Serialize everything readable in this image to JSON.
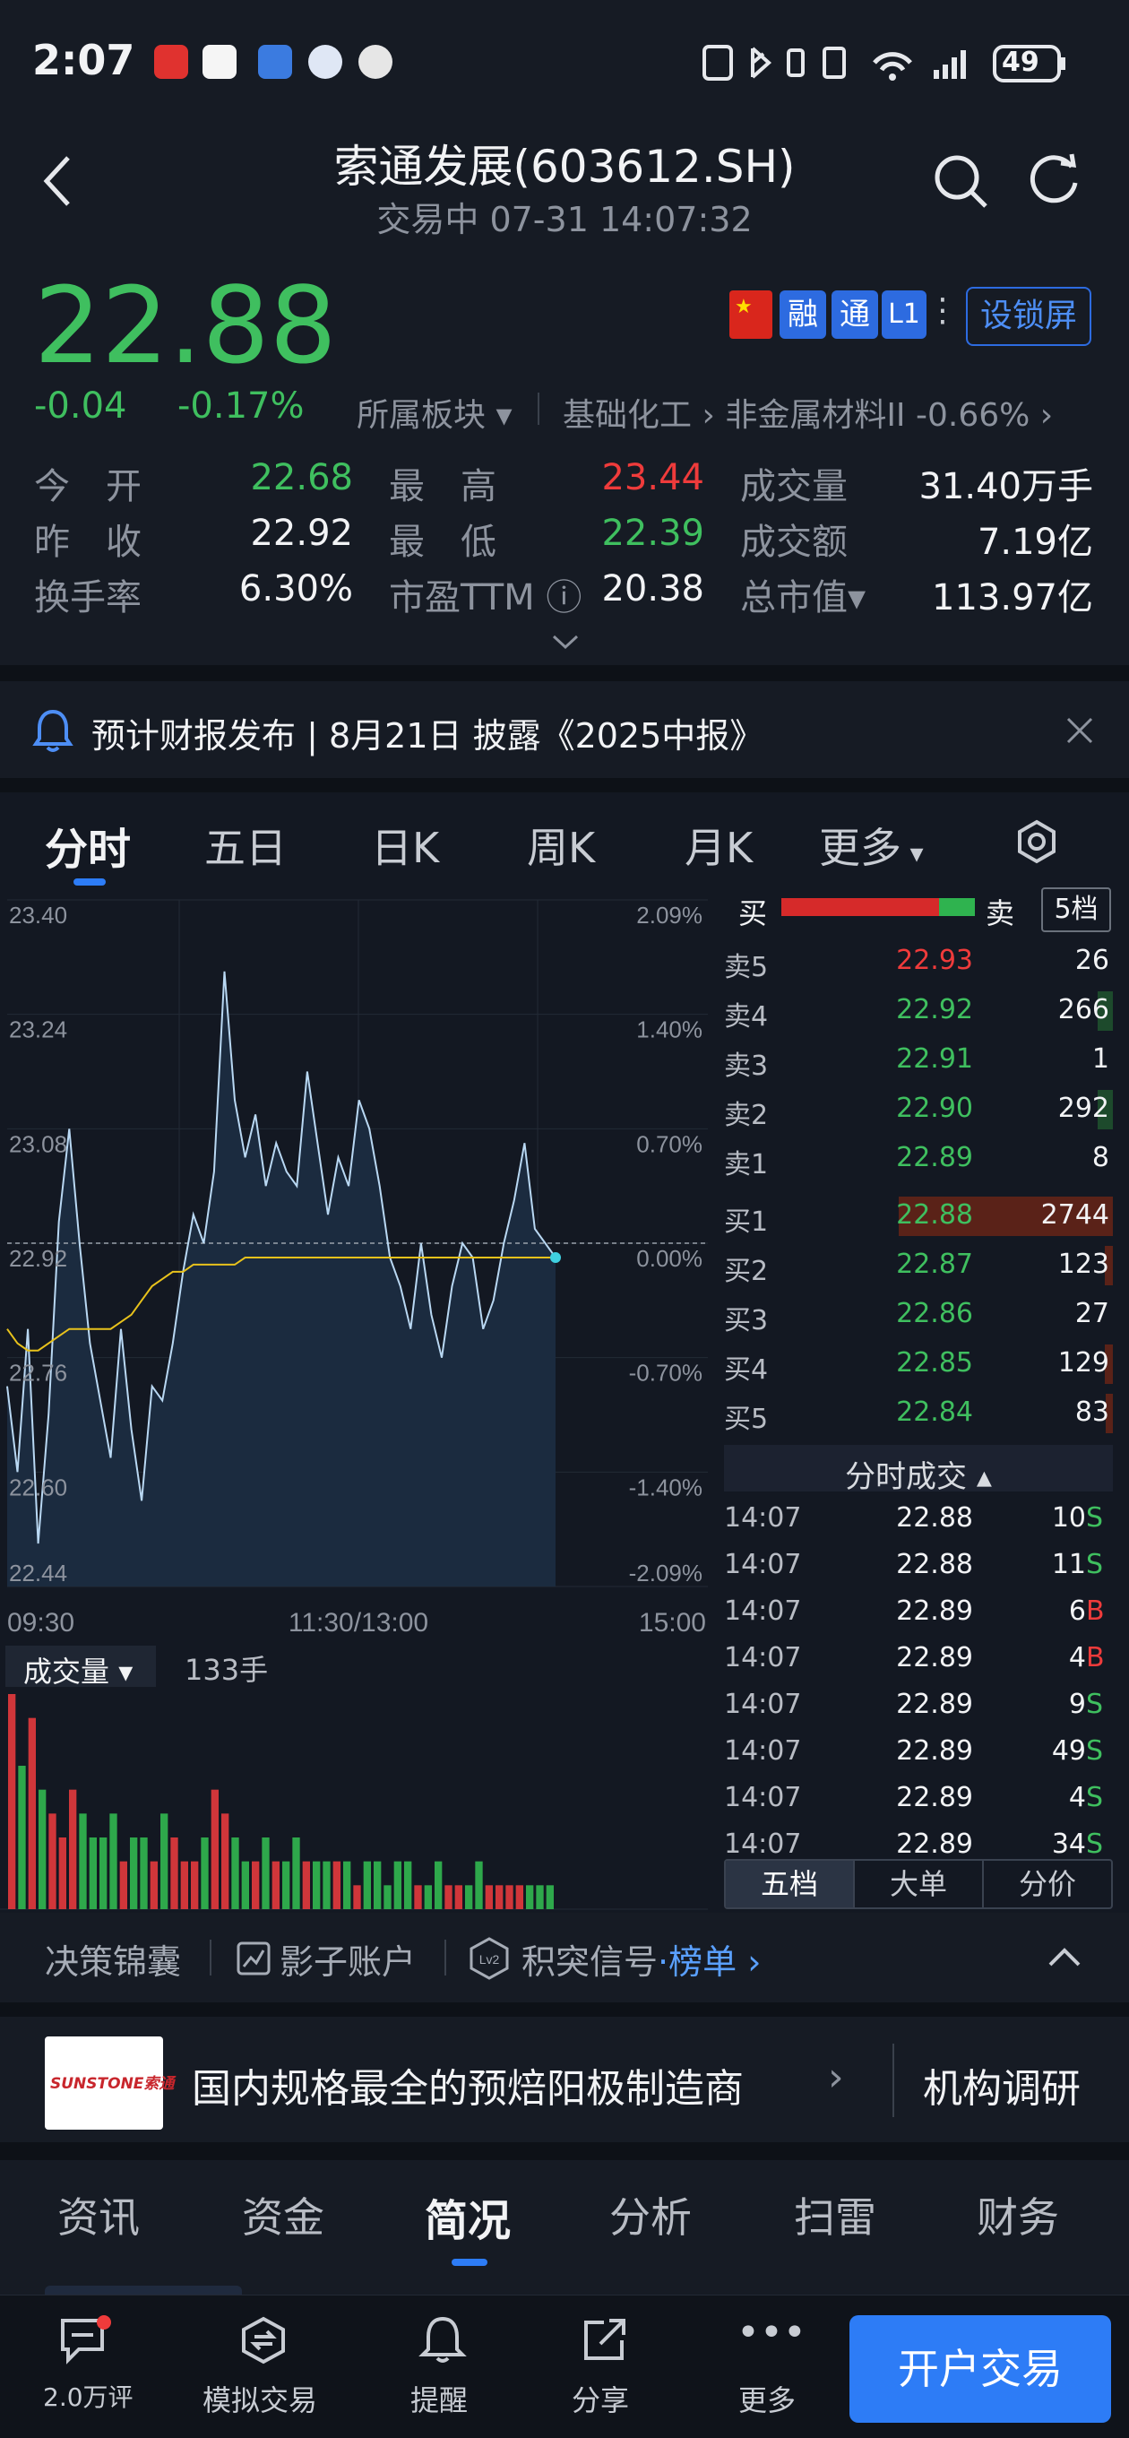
{
  "status": {
    "time": "2:07",
    "battery": "49"
  },
  "header": {
    "title": "索通发展(603612.SH)",
    "subtitle": "交易中 07-31 14:07:32"
  },
  "quote": {
    "price": "22.88",
    "change": "-0.04",
    "change_pct": "-0.17%",
    "badges": [
      "融",
      "通",
      "L1"
    ],
    "lock_button": "设锁屏",
    "sector_label": "所属板块",
    "sector1": "基础化工",
    "sector2": "非金属材料II -0.66%",
    "rows": [
      {
        "l1": "今　开",
        "v1": "22.68",
        "l2": "最　高",
        "v2": "23.44",
        "l3": "成交量",
        "v3": "31.40万手"
      },
      {
        "l1": "昨　收",
        "v1": "22.92",
        "l2": "最　低",
        "v2": "22.39",
        "l3": "成交额",
        "v3": "7.19亿"
      },
      {
        "l1": "换手率",
        "v1": "6.30%",
        "l2": "市盈TTM",
        "v2": "20.38",
        "l3": "总市值",
        "v3": "113.97亿"
      }
    ]
  },
  "notice": {
    "text": "预计财报发布 | 8月21日 披露《2025中报》"
  },
  "chart_tabs": [
    "分时",
    "五日",
    "日K",
    "周K",
    "月K",
    "更多"
  ],
  "chart_data": {
    "type": "line",
    "y_labels_left": [
      "23.40",
      "23.24",
      "23.08",
      "22.92",
      "22.76",
      "22.60",
      "22.44"
    ],
    "y_labels_right": [
      "2.09%",
      "1.40%",
      "0.70%",
      "0.00%",
      "-0.70%",
      "-1.40%",
      "-2.09%"
    ],
    "ylim": [
      22.44,
      23.4
    ],
    "x_labels": [
      "09:30",
      "11:30/13:00",
      "15:00"
    ],
    "prev_close": 22.92,
    "price_series": [
      22.72,
      22.6,
      22.8,
      22.5,
      22.68,
      22.95,
      23.08,
      22.92,
      22.78,
      22.7,
      22.62,
      22.8,
      22.66,
      22.56,
      22.72,
      22.7,
      22.78,
      22.88,
      22.96,
      22.92,
      23.02,
      23.3,
      23.12,
      23.04,
      23.1,
      23.0,
      23.06,
      23.02,
      23.0,
      23.16,
      23.06,
      22.96,
      23.04,
      23.0,
      23.12,
      23.08,
      23.0,
      22.9,
      22.86,
      22.8,
      22.92,
      22.82,
      22.76,
      22.86,
      22.92,
      22.9,
      22.8,
      22.84,
      22.92,
      22.98,
      23.06,
      22.94,
      22.92,
      22.9
    ],
    "avg_series": [
      22.8,
      22.78,
      22.77,
      22.77,
      22.78,
      22.79,
      22.8,
      22.8,
      22.8,
      22.8,
      22.8,
      22.81,
      22.82,
      22.84,
      22.86,
      22.87,
      22.88,
      22.88,
      22.89,
      22.89,
      22.89,
      22.89,
      22.89,
      22.9,
      22.9,
      22.9,
      22.9,
      22.9,
      22.9,
      22.9,
      22.9,
      22.9,
      22.9,
      22.9,
      22.9,
      22.9,
      22.9,
      22.9,
      22.9,
      22.9,
      22.9,
      22.9,
      22.9,
      22.9,
      22.9,
      22.9,
      22.9,
      22.9,
      22.9,
      22.9,
      22.9,
      22.9,
      22.9,
      22.9
    ],
    "volume_label": "成交量",
    "volume_value": "133手",
    "volumes": [
      9,
      6,
      8,
      5,
      4,
      3,
      5,
      4,
      3,
      3,
      4,
      2,
      3,
      3,
      2,
      4,
      3,
      2,
      2,
      3,
      5,
      4,
      3,
      2,
      2,
      3,
      2,
      2,
      3,
      2,
      2,
      2,
      2,
      2,
      1,
      2,
      2,
      1,
      2,
      2,
      1,
      1,
      2,
      1,
      1,
      1,
      2,
      1,
      1,
      1,
      1,
      1,
      1,
      1
    ]
  },
  "orderbook": {
    "buy_label": "买",
    "sell_label": "卖",
    "levels_button": "5档",
    "sells": [
      {
        "label": "卖5",
        "price": "22.93",
        "vol": "26",
        "up": true,
        "bar": 0.0
      },
      {
        "label": "卖4",
        "price": "22.92",
        "vol": "266",
        "up": false,
        "bar": 0.04
      },
      {
        "label": "卖3",
        "price": "22.91",
        "vol": "1",
        "up": false,
        "bar": 0.0
      },
      {
        "label": "卖2",
        "price": "22.90",
        "vol": "292",
        "up": false,
        "bar": 0.04
      },
      {
        "label": "卖1",
        "price": "22.89",
        "vol": "8",
        "up": false,
        "bar": 0.0
      }
    ],
    "buys": [
      {
        "label": "买1",
        "price": "22.88",
        "vol": "2744",
        "bar": 0.55
      },
      {
        "label": "买2",
        "price": "22.87",
        "vol": "123",
        "bar": 0.02
      },
      {
        "label": "买3",
        "price": "22.86",
        "vol": "27",
        "bar": 0.0
      },
      {
        "label": "买4",
        "price": "22.85",
        "vol": "129",
        "bar": 0.02
      },
      {
        "label": "买5",
        "price": "22.84",
        "vol": "83",
        "bar": 0.01
      }
    ],
    "trades_title": "分时成交",
    "trades": [
      {
        "time": "14:07",
        "price": "22.88",
        "vol": "10",
        "side": "S"
      },
      {
        "time": "14:07",
        "price": "22.88",
        "vol": "11",
        "side": "S"
      },
      {
        "time": "14:07",
        "price": "22.89",
        "vol": "6",
        "side": "B"
      },
      {
        "time": "14:07",
        "price": "22.89",
        "vol": "4",
        "side": "B"
      },
      {
        "time": "14:07",
        "price": "22.89",
        "vol": "9",
        "side": "S"
      },
      {
        "time": "14:07",
        "price": "22.89",
        "vol": "49",
        "side": "S"
      },
      {
        "time": "14:07",
        "price": "22.89",
        "vol": "4",
        "side": "S"
      },
      {
        "time": "14:07",
        "price": "22.89",
        "vol": "34",
        "side": "S"
      }
    ],
    "bottom_tabs": [
      "五档",
      "大单",
      "分价"
    ]
  },
  "links": {
    "l1": "决策锦囊",
    "l2": "影子账户",
    "l3": "积突信号",
    "l3b": "榜单"
  },
  "banner": {
    "logo": "SUNSTONE索通",
    "text": "国内规格最全的预焙阳极制造商",
    "right": "机构调研"
  },
  "content_tabs": [
    "资讯",
    "资金",
    "简况",
    "分析",
    "扫雷",
    "财务"
  ],
  "nav": {
    "comments": "2.0万评",
    "sim": "模拟交易",
    "alert": "提醒",
    "share": "分享",
    "more": "更多",
    "trade": "开户交易"
  }
}
